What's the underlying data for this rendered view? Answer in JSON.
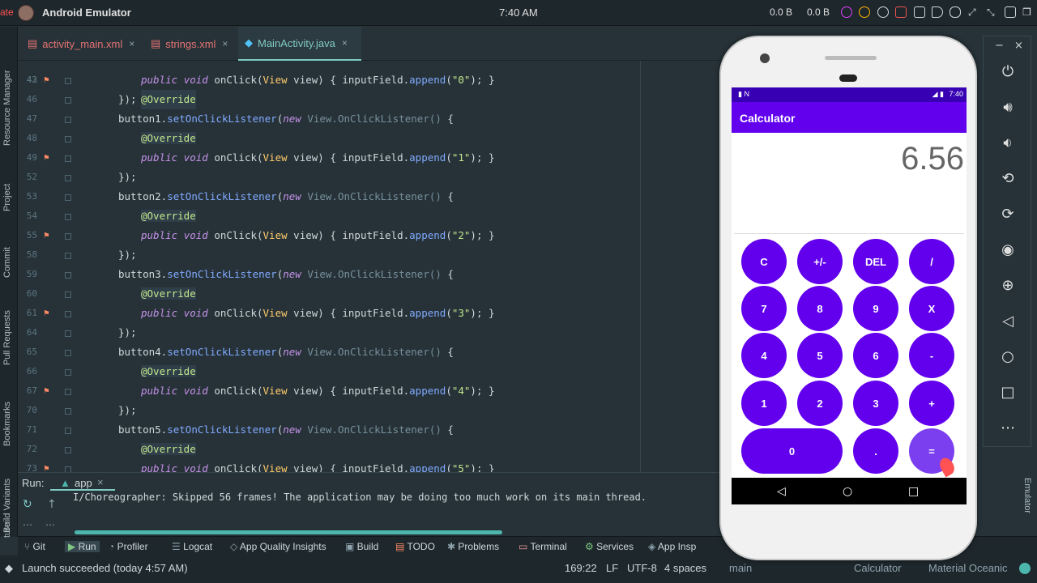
{
  "system": {
    "app_title": "Android Emulator",
    "clock": "7:40 AM",
    "net_up": "0.0 B",
    "net_down": "0.0 B",
    "left_tag": "ate"
  },
  "sidebar_left": [
    "Resource Manager",
    "Project",
    "Commit",
    "Pull Requests",
    "Bookmarks",
    "Build Variants",
    "ture"
  ],
  "tabs": [
    {
      "label": "activity_main.xml"
    },
    {
      "label": "strings.xml"
    },
    {
      "label": "MainActivity.java"
    }
  ],
  "code": {
    "partial_top": "@Override",
    "lines": [
      {
        "num": "43",
        "text": "public void onClick(View view) { inputField.append(\"0\"); }"
      },
      {
        "num": "46",
        "text": "});"
      },
      {
        "num": "47",
        "text": "button1.setOnClickListener(new View.OnClickListener() {"
      },
      {
        "num": "48",
        "text": "@Override"
      },
      {
        "num": "49",
        "text": "public void onClick(View view) { inputField.append(\"1\"); }"
      },
      {
        "num": "52",
        "text": "});"
      },
      {
        "num": "53",
        "text": "button2.setOnClickListener(new View.OnClickListener() {"
      },
      {
        "num": "54",
        "text": "@Override"
      },
      {
        "num": "55",
        "text": "public void onClick(View view) { inputField.append(\"2\"); }"
      },
      {
        "num": "58",
        "text": "});"
      },
      {
        "num": "59",
        "text": "button3.setOnClickListener(new View.OnClickListener() {"
      },
      {
        "num": "60",
        "text": "@Override"
      },
      {
        "num": "61",
        "text": "public void onClick(View view) { inputField.append(\"3\"); }"
      },
      {
        "num": "64",
        "text": "});"
      },
      {
        "num": "65",
        "text": "button4.setOnClickListener(new View.OnClickListener() {"
      },
      {
        "num": "66",
        "text": "@Override"
      },
      {
        "num": "67",
        "text": "public void onClick(View view) { inputField.append(\"4\"); }"
      },
      {
        "num": "70",
        "text": "});"
      },
      {
        "num": "71",
        "text": "button5.setOnClickListener(new View.OnClickListener() {"
      },
      {
        "num": "72",
        "text": "@Override"
      },
      {
        "num": "73",
        "text": "public void onClick(View view) { inputField.append(\"5\"); }"
      }
    ]
  },
  "run": {
    "label": "Run:",
    "config": "app",
    "log": "I/Choreographer: Skipped 56 frames!  The application may be doing too much work on its main thread."
  },
  "tool_windows": [
    "Git",
    "Run",
    "Profiler",
    "Logcat",
    "App Quality Insights",
    "Build",
    "TODO",
    "Problems",
    "Terminal",
    "Services",
    "App Insp"
  ],
  "status": {
    "message": "Launch succeeded (today 4:57 AM)",
    "position": "169:22",
    "line_sep": "LF",
    "encoding": "UTF-8",
    "indent": "4 spaces",
    "branch": "main",
    "project": "Calculator",
    "theme": "Material Oceanic"
  },
  "emulator": {
    "status_time": "7:40",
    "app_title": "Calculator",
    "display_value": "6.56",
    "keys": [
      "C",
      "+/-",
      "DEL",
      "/",
      "7",
      "8",
      "9",
      "X",
      "4",
      "5",
      "6",
      "-",
      "1",
      "2",
      "3",
      "+",
      "0",
      ".",
      "="
    ],
    "panel_label": "Emulator"
  }
}
